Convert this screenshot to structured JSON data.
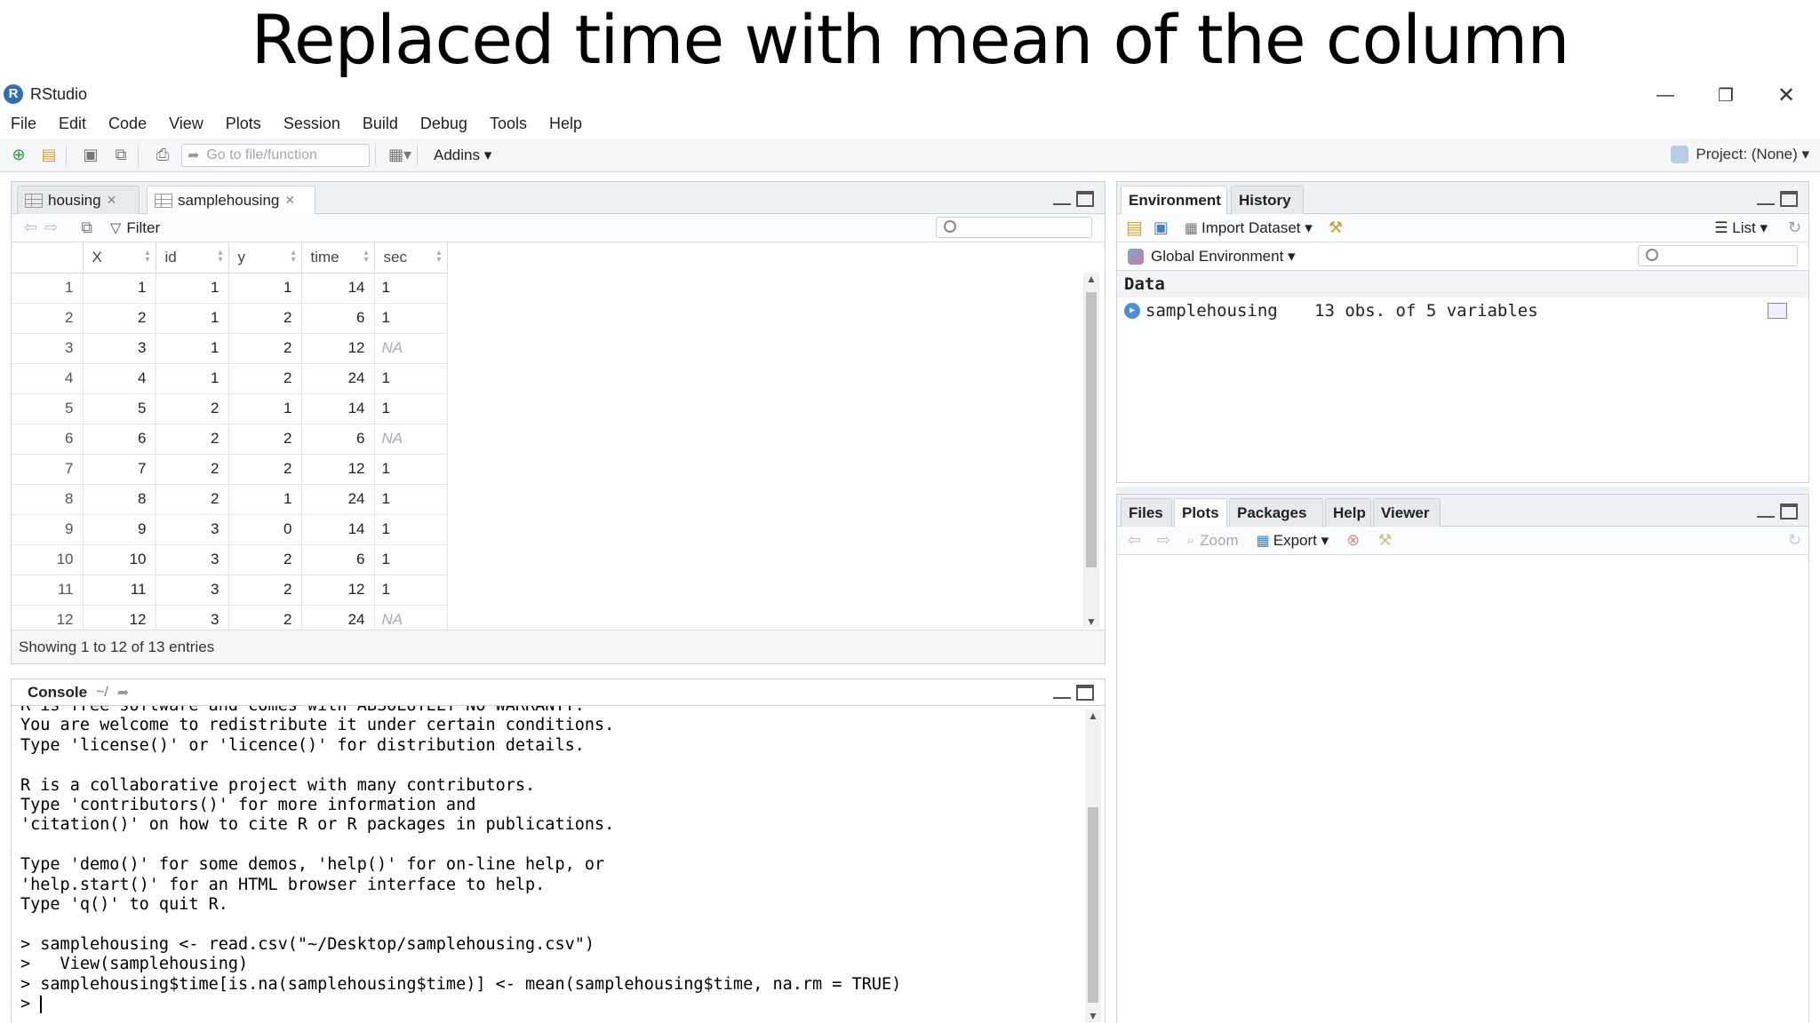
{
  "slide": {
    "title": "Replaced time with mean of the column"
  },
  "window": {
    "app_name": "RStudio"
  },
  "menu": [
    "File",
    "Edit",
    "Code",
    "View",
    "Plots",
    "Session",
    "Build",
    "Debug",
    "Tools",
    "Help"
  ],
  "toolbar": {
    "goto_placeholder": "Go to file/function",
    "addins_label": "Addins",
    "project_label": "Project: (None)"
  },
  "source_pane": {
    "tabs": [
      {
        "label": "housing"
      },
      {
        "label": "samplehousing"
      }
    ],
    "filter_label": "Filter",
    "columns": [
      "X",
      "id",
      "y",
      "time",
      "sec"
    ],
    "rows": [
      {
        "n": "1",
        "cells": [
          "1",
          "1",
          "1",
          "14",
          "1"
        ]
      },
      {
        "n": "2",
        "cells": [
          "2",
          "1",
          "2",
          "6",
          "1"
        ]
      },
      {
        "n": "3",
        "cells": [
          "3",
          "1",
          "2",
          "12",
          "NA"
        ]
      },
      {
        "n": "4",
        "cells": [
          "4",
          "1",
          "2",
          "24",
          "1"
        ]
      },
      {
        "n": "5",
        "cells": [
          "5",
          "2",
          "1",
          "14",
          "1"
        ]
      },
      {
        "n": "6",
        "cells": [
          "6",
          "2",
          "2",
          "6",
          "NA"
        ]
      },
      {
        "n": "7",
        "cells": [
          "7",
          "2",
          "2",
          "12",
          "1"
        ]
      },
      {
        "n": "8",
        "cells": [
          "8",
          "2",
          "1",
          "24",
          "1"
        ]
      },
      {
        "n": "9",
        "cells": [
          "9",
          "3",
          "0",
          "14",
          "1"
        ]
      },
      {
        "n": "10",
        "cells": [
          "10",
          "3",
          "2",
          "6",
          "1"
        ]
      },
      {
        "n": "11",
        "cells": [
          "11",
          "3",
          "2",
          "12",
          "1"
        ]
      },
      {
        "n": "12",
        "cells": [
          "12",
          "3",
          "2",
          "24",
          "NA"
        ]
      }
    ],
    "status": "Showing 1 to 12 of 13 entries"
  },
  "console": {
    "title": "Console",
    "path": "~/",
    "clipped_line": "R is free software and comes with ABSOLUTELY NO WARRANTY.",
    "lines": [
      "You are welcome to redistribute it under certain conditions.",
      "Type 'license()' or 'licence()' for distribution details.",
      "",
      "R is a collaborative project with many contributors.",
      "Type 'contributors()' for more information and",
      "'citation()' on how to cite R or R packages in publications.",
      "",
      "Type 'demo()' for some demos, 'help()' for on-line help, or",
      "'help.start()' for an HTML browser interface to help.",
      "Type 'q()' to quit R.",
      ""
    ],
    "commands": [
      "> samplehousing <- read.csv(\"~/Desktop/samplehousing.csv\")",
      ">   View(samplehousing)",
      "> samplehousing$time[is.na(samplehousing$time)] <- mean(samplehousing$time, na.rm = TRUE)"
    ],
    "prompt": "> "
  },
  "env_pane": {
    "tabs": [
      "Environment",
      "History"
    ],
    "import_label": "Import Dataset",
    "list_label": "List",
    "scope_label": "Global Environment",
    "section_label": "Data",
    "items": [
      {
        "name": "samplehousing",
        "desc": "13 obs. of 5 variables"
      }
    ]
  },
  "files_pane": {
    "tabs": [
      "Files",
      "Plots",
      "Packages",
      "Help",
      "Viewer"
    ],
    "zoom_label": "Zoom",
    "export_label": "Export"
  }
}
